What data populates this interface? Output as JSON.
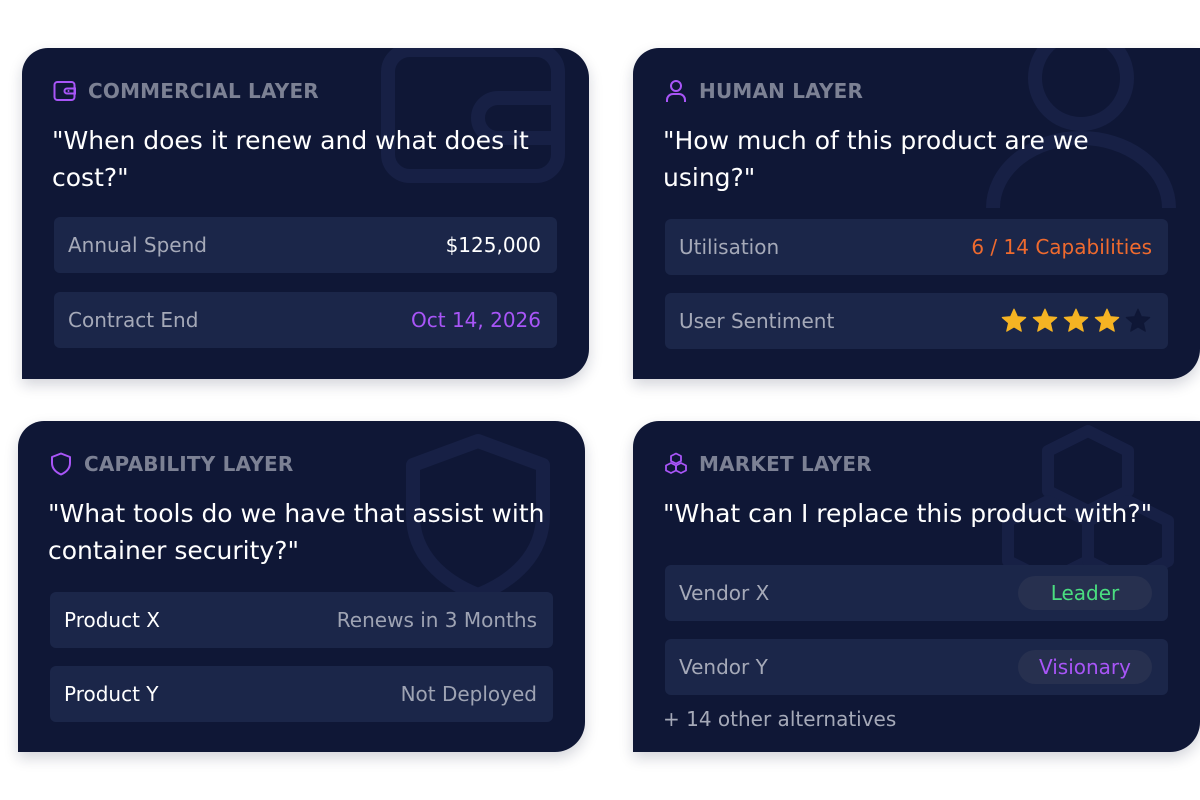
{
  "colors": {
    "card_bg": "#0f1736",
    "row_bg": "#1b2649",
    "accent_purple": "#a855f7",
    "accent_orange": "#ef6a2e",
    "accent_green": "#4ade80",
    "star_gold": "#f5b323"
  },
  "commercial": {
    "icon": "wallet-icon",
    "title": "COMMERCIAL LAYER",
    "question": "\"When does it renew and what does it cost?\"",
    "rows": [
      {
        "label": "Annual Spend",
        "value": "$125,000"
      },
      {
        "label": "Contract End",
        "value": "Oct 14, 2026"
      }
    ]
  },
  "human": {
    "icon": "user-icon",
    "title": "HUMAN LAYER",
    "question": "\"How much of this product are we using?\"",
    "utilisation": {
      "label": "Utilisation",
      "value": "6 / 14 Capabilities"
    },
    "sentiment": {
      "label": "User Sentiment",
      "rating": 4,
      "max": 5
    }
  },
  "capability": {
    "icon": "shield-icon",
    "title": "CAPABILITY LAYER",
    "question": "\"What tools do we have that assist with container security?\"",
    "rows": [
      {
        "label": "Product X",
        "value": "Renews in 3 Months"
      },
      {
        "label": "Product Y",
        "value": "Not Deployed"
      }
    ]
  },
  "market": {
    "icon": "cubes-icon",
    "title": "MARKET LAYER",
    "question": "\"What can I replace this product with?\"",
    "rows": [
      {
        "label": "Vendor X",
        "badge": "Leader"
      },
      {
        "label": "Vendor Y",
        "badge": "Visionary"
      }
    ],
    "more": "+ 14 other alternatives"
  }
}
